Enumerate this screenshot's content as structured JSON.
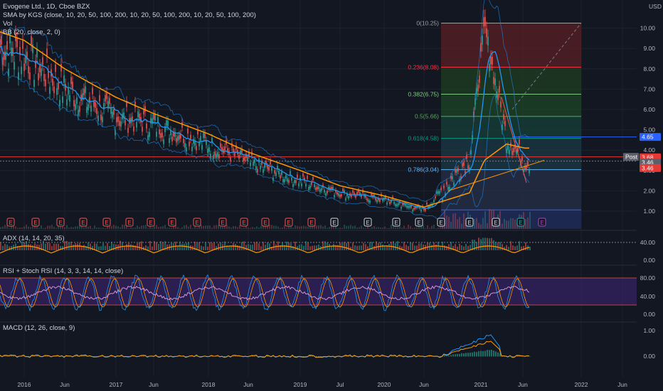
{
  "header": {
    "title": "Evogene Ltd., 1D, Cboe BZX",
    "indicators": [
      "SMA by KGS (close, 10, 20, 50, 100, 200, 10, 20, 50, 100, 200, 10, 20, 50, 100, 200)",
      "Vol",
      "BB (20, close, 2, 0)"
    ]
  },
  "price_axis": {
    "currency": "USD",
    "ticks": [
      "10.00",
      "9.00",
      "8.00",
      "7.00",
      "6.00",
      "5.00",
      "4.00",
      "3.00",
      "2.00",
      "1.00"
    ],
    "badges": [
      {
        "label": "4.65",
        "value": 4.65,
        "color": "#2962ff"
      },
      {
        "label": "3.68",
        "value": 3.68,
        "color": "#e53935"
      },
      {
        "label": "Post",
        "value": 3.46,
        "color": "#5d606b"
      },
      {
        "label": "3.46",
        "value": 3.46,
        "color": "#5d606b"
      },
      {
        "label": "3.46",
        "value": 3.4,
        "color": "#e53935"
      }
    ]
  },
  "fib_levels": [
    {
      "label": "0(10.25)",
      "value": 10.25,
      "color": "#9e9e9e"
    },
    {
      "label": "0.236(8.08)",
      "value": 8.08,
      "color": "#f23645"
    },
    {
      "label": "0.382(6.75)",
      "value": 6.75,
      "color": "#81c784"
    },
    {
      "label": "0.5(5.66)",
      "value": 5.66,
      "color": "#4caf50"
    },
    {
      "label": "0.618(4.58)",
      "value": 4.58,
      "color": "#089981"
    },
    {
      "label": "0.786(3.04)",
      "value": 3.04,
      "color": "#64b5f6"
    },
    {
      "label": "",
      "value": 1.06,
      "color": "#2962ff"
    }
  ],
  "earnings_markers": [
    "E",
    "E",
    "E",
    "E",
    "E",
    "E",
    "E",
    "E",
    "E",
    "E",
    "E",
    "E",
    "E",
    "E",
    "E",
    "E",
    "E",
    "E",
    "E",
    "E",
    "E",
    "E",
    "E"
  ],
  "panes": {
    "adx": {
      "title": "ADX (14, 14, 20, 35)",
      "ticks": [
        "40.00",
        "0.00"
      ]
    },
    "rsi": {
      "title": "RSI + Stoch RSI (14, 3, 3, 14, 14, close)",
      "ticks": [
        "80.00",
        "40.00",
        "0.00"
      ]
    },
    "macd": {
      "title": "MACD (12, 26, close, 9)",
      "ticks": [
        "1.00",
        "0.00"
      ]
    }
  },
  "time_axis": [
    "2016",
    "Jun",
    "2017",
    "Jun",
    "2018",
    "Jun",
    "2019",
    "Jul",
    "2020",
    "Jun",
    "2021",
    "Jun",
    "2022",
    "Jun"
  ],
  "chart_data": {
    "type": "line",
    "title": "Evogene Ltd., 1D, Cboe BZX",
    "x": [
      "2016",
      "Jun 2016",
      "2017",
      "Jun 2017",
      "2018",
      "Jun 2018",
      "2019",
      "Jul 2019",
      "2020",
      "Jun 2020",
      "Nov 2020",
      "Feb 2021",
      "Apr 2021",
      "Jun 2021"
    ],
    "series": [
      {
        "name": "close",
        "values": [
          8.6,
          7.0,
          5.6,
          5.3,
          4.3,
          3.4,
          2.5,
          1.9,
          1.55,
          1.05,
          3.6,
          10.0,
          4.6,
          3.46
        ]
      },
      {
        "name": "SMA 200",
        "values": [
          9.4,
          8.0,
          6.6,
          5.8,
          4.8,
          3.9,
          3.0,
          2.25,
          1.75,
          1.2,
          1.9,
          3.5,
          4.3,
          4.1
        ]
      }
    ],
    "ylim": [
      0,
      11
    ],
    "y_scale": "linear",
    "grid": true,
    "trendlines": [
      {
        "from": {
          "x": "Jun 2020",
          "y": 2.0
        },
        "to": {
          "x": "Jul 2021",
          "y": 3.5
        }
      },
      {
        "from": {
          "x": "Apr 2021",
          "y": 3.04
        },
        "to": {
          "x": "Dec 2021",
          "y": 10.25
        }
      }
    ]
  },
  "colors": {
    "background": "#131722",
    "grid": "#1e222d",
    "axis_text": "#b2b5be",
    "candle_up": "#26a69a",
    "candle_down": "#ef5350",
    "sma_fast": "#2196f3",
    "sma_slow": "#ff9800",
    "bb": "#1e88e5"
  }
}
